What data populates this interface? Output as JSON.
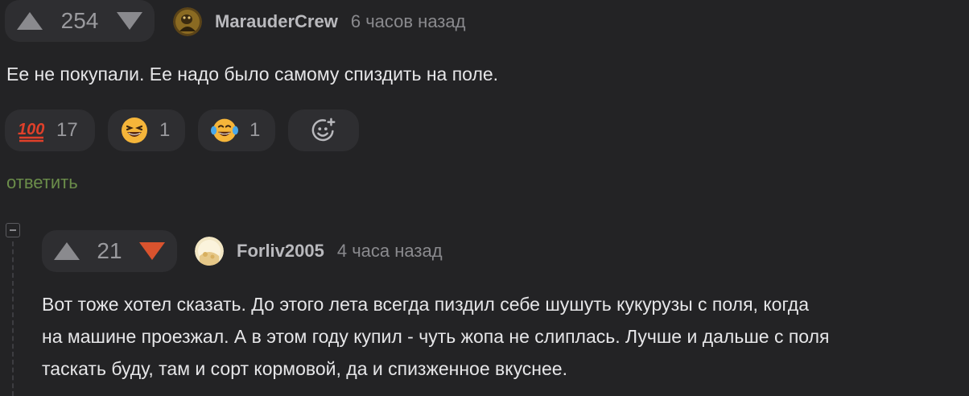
{
  "comment1": {
    "votes": "254",
    "author": "MarauderCrew",
    "time": "6 часов назад",
    "text": "Ее не покупали. Ее надо было самому спиздить на поле.",
    "reactions": [
      {
        "icon": "hundred-points-icon",
        "count": "17"
      },
      {
        "icon": "grinning-squinting-face-icon",
        "count": "1"
      },
      {
        "icon": "tears-of-joy-face-icon",
        "count": "1"
      }
    ],
    "add_reaction_icon": "add-reaction-icon",
    "reply_label": "ответить"
  },
  "comment2": {
    "votes": "21",
    "author": "Forliv2005",
    "time": "4 часа назад",
    "text_lines": [
      "Вот тоже хотел сказать. До этого лета всегда пиздил себе шушуть кукурузы с поля, когда",
      "на машине проезжал. А в этом году купил - чуть жопа не слиплась. Лучше и дальше с поля",
      "таскать буду, там и сорт кормовой, да и спизженное вкуснее."
    ]
  },
  "colors": {
    "background": "#232325",
    "pill": "#2e2e31",
    "upvote_arrow": "#8a8a8e",
    "downvote_active": "#d9532e",
    "reply_link": "#6b8d4a"
  }
}
